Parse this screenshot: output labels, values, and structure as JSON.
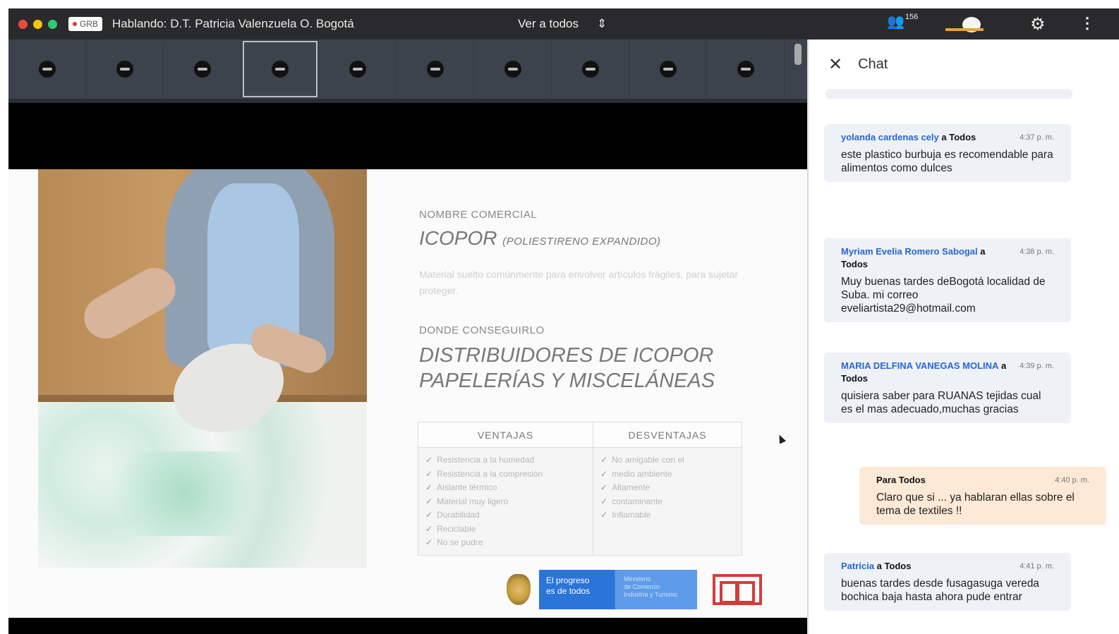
{
  "topbar": {
    "window_dots": [
      "#e84c3d",
      "#f1c40f",
      "#2ecc71"
    ],
    "rec_label": "GRB",
    "speaking": "Hablando: D.T. Patricia Valenzuela O. Bogotá",
    "view_all": "Ver a todos",
    "view_all_chevron": "⌃",
    "participants_count": "156",
    "accent": "#e8a040"
  },
  "strip": {
    "tiles": [
      "",
      "",
      "",
      "",
      "",
      "",
      "",
      "",
      "",
      ""
    ],
    "active_index": 3
  },
  "slide": {
    "label_trade_name": "NOMBRE COMERCIAL",
    "product_name": "ICOPOR",
    "product_sub": "(POLIESTIRENO EXPANDIDO)",
    "description": "Material suelto comúnmente para envolver artículos frágiles, para sujetar proteger.",
    "label_where": "DONDE CONSEGUIRLO",
    "where_line1": "DISTRIBUIDORES DE ICOPOR",
    "where_line2": "PAPELERÍAS Y MISCELÁNEAS",
    "table": {
      "headers": [
        "VENTAJAS",
        "DESVENTAJAS"
      ],
      "ventajas": [
        "Resistencia a la humedad",
        "Resistencia a la compresión",
        "Aislante térmico",
        "Material muy ligero",
        "Durabilidad",
        "Reciclable",
        "No se pudre"
      ],
      "desventajas": [
        "No amigable con el",
        "medio ambiente",
        "Altamente",
        "contaminante",
        "Inflamable"
      ]
    },
    "logo_left": "El progreso\nes de todos",
    "logo_right": "Ministerio\nde Comercio\nIndustria y Turismo"
  },
  "chat": {
    "title": "Chat",
    "messages": [
      {
        "sender": "yolanda cardenas cely",
        "to": "a Todos",
        "time": "4:37 p. m.",
        "text": "este plastico burbuja es recomendable para alimentos como dulces"
      },
      {
        "sender": "Myriam Evelia Romero Sabogal",
        "to": "a Todos",
        "time": "4:38 p. m.",
        "text": "Muy buenas tardes deBogotá localidad de Suba. mi correo eveliartista29@hotmail.com"
      },
      {
        "sender": "MARIA DELFINA VANEGAS MOLINA",
        "to": "a Todos",
        "time": "4:39 p. m.",
        "text": "quisiera saber para RUANAS tejidas cual es el mas adecuado,muchas gracias"
      },
      {
        "sender": "Para Todos",
        "to": "",
        "time": "4:40 p. m.",
        "text": "Claro que si ... ya hablaran ellas sobre el tema de textiles !!"
      },
      {
        "sender": "Patricia",
        "to": "a Todos",
        "time": "4:41 p. m.",
        "text": "buenas tardes desde fusagasuga vereda bochica baja hasta ahora pude entrar"
      }
    ]
  }
}
